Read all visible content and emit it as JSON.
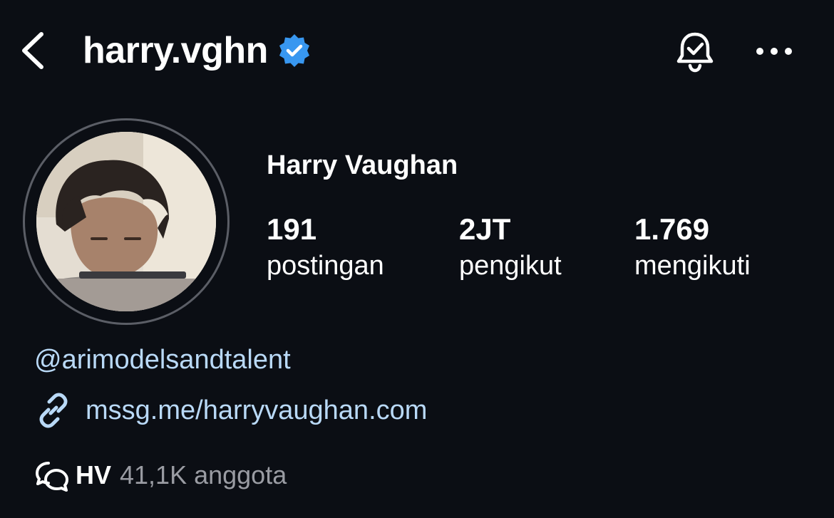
{
  "header": {
    "username": "harry.vghn",
    "back_icon": "chevron-left-icon",
    "verified_icon": "verified-badge-icon",
    "bell_icon": "bell-check-icon",
    "more_icon": "more-horizontal-icon"
  },
  "profile": {
    "full_name": "Harry Vaughan",
    "avatar_icon": "profile-photo"
  },
  "stats": [
    {
      "value": "191",
      "label": "postingan"
    },
    {
      "value": "2JT",
      "label": "pengikut"
    },
    {
      "value": "1.769",
      "label": "mengikuti"
    }
  ],
  "bio": {
    "mention": "@arimodelsandtalent",
    "link_icon": "link-icon",
    "link": "mssg.me/harryvaughan.com"
  },
  "channel": {
    "icon": "chat-bubbles-icon",
    "name": "HV",
    "members": "41,1K anggota"
  },
  "colors": {
    "background": "#0b0e14",
    "text": "#ffffff",
    "link": "#b9d9f7",
    "muted": "#9a9ca3",
    "verified": "#3897f0",
    "avatar_ring": "#5b5e66"
  }
}
